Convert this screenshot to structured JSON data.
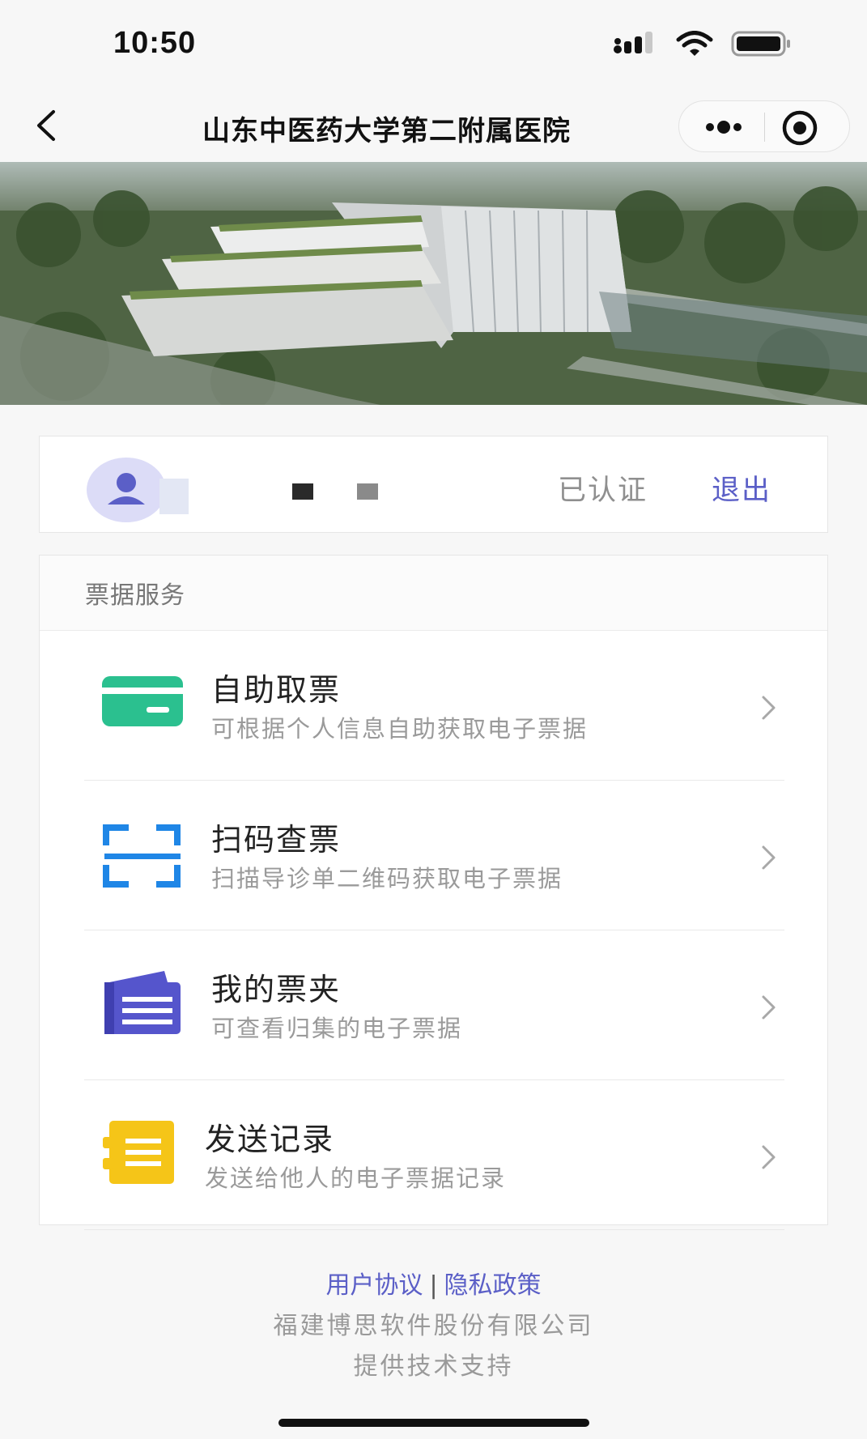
{
  "status_bar": {
    "time": "10:50"
  },
  "nav": {
    "title": "山东中医药大学第二附属医院"
  },
  "user": {
    "verified_label": "已认证",
    "logout_label": "退出"
  },
  "services": {
    "header": "票据服务",
    "items": [
      {
        "title": "自助取票",
        "subtitle": "可根据个人信息自助获取电子票据",
        "icon": "card-icon",
        "color": "#2bc08f"
      },
      {
        "title": "扫码查票",
        "subtitle": "扫描导诊单二维码获取电子票据",
        "icon": "scan-icon",
        "color": "#1f86e6"
      },
      {
        "title": "我的票夹",
        "subtitle": "可查看归集的电子票据",
        "icon": "folder-icon",
        "color": "#5555cc"
      },
      {
        "title": "发送记录",
        "subtitle": "发送给他人的电子票据记录",
        "icon": "record-icon",
        "color": "#f5c518"
      }
    ]
  },
  "footer": {
    "user_agreement": "用户协议",
    "separator": "|",
    "privacy_policy": "隐私政策",
    "company": "福建博思软件股份有限公司",
    "support": "提供技术支持"
  }
}
